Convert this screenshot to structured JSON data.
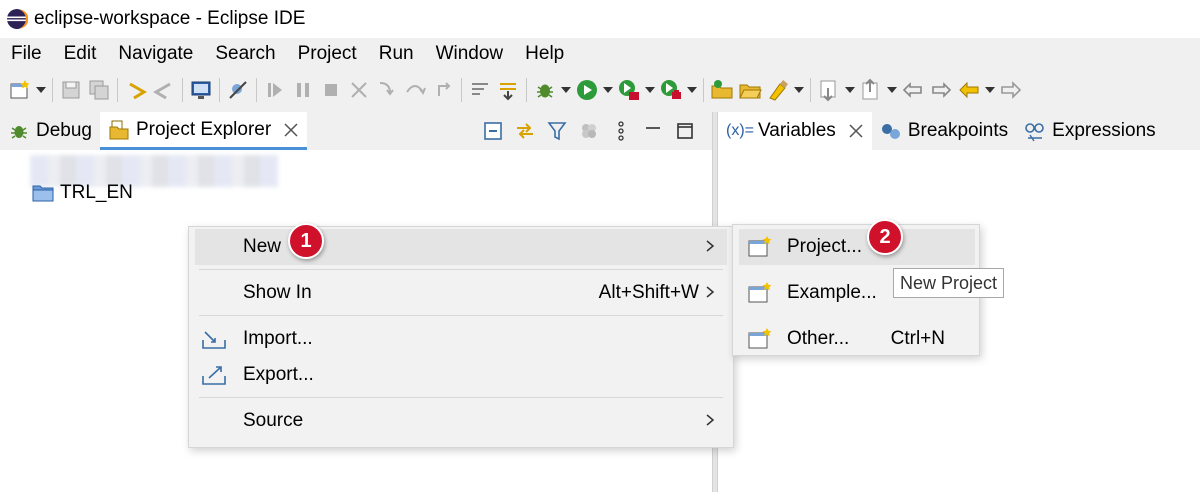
{
  "window": {
    "title": "eclipse-workspace - Eclipse IDE"
  },
  "menubar": {
    "items": [
      "File",
      "Edit",
      "Navigate",
      "Search",
      "Project",
      "Run",
      "Window",
      "Help"
    ]
  },
  "left_panel": {
    "tabs": [
      {
        "label": "Debug",
        "icon": "bug-icon"
      },
      {
        "label": "Project Explorer",
        "icon": "project-explorer-icon"
      }
    ],
    "tree_items": [
      "TRL_EN"
    ]
  },
  "right_panel": {
    "tabs": [
      {
        "label": "Variables",
        "icon": "variables-icon",
        "icon_text": "(x)="
      },
      {
        "label": "Breakpoints",
        "icon": "breakpoints-icon"
      },
      {
        "label": "Expressions",
        "icon": "expressions-icon"
      }
    ]
  },
  "context_menu": {
    "new": {
      "label": "New"
    },
    "show_in": {
      "label": "Show In",
      "shortcut": "Alt+Shift+W"
    },
    "import": {
      "label": "Import..."
    },
    "export": {
      "label": "Export..."
    },
    "source": {
      "label": "Source"
    }
  },
  "submenu": {
    "project": {
      "label": "Project..."
    },
    "example": {
      "label": "Example..."
    },
    "other": {
      "label": "Other...",
      "shortcut": "Ctrl+N"
    }
  },
  "tooltip": {
    "text": "New Project"
  },
  "callouts": {
    "one": "1",
    "two": "2"
  },
  "colors": {
    "accent": "#4a90d9",
    "badge": "#d0112b",
    "menu_bg": "#f2f2f2",
    "hover": "#e4e4e4"
  }
}
